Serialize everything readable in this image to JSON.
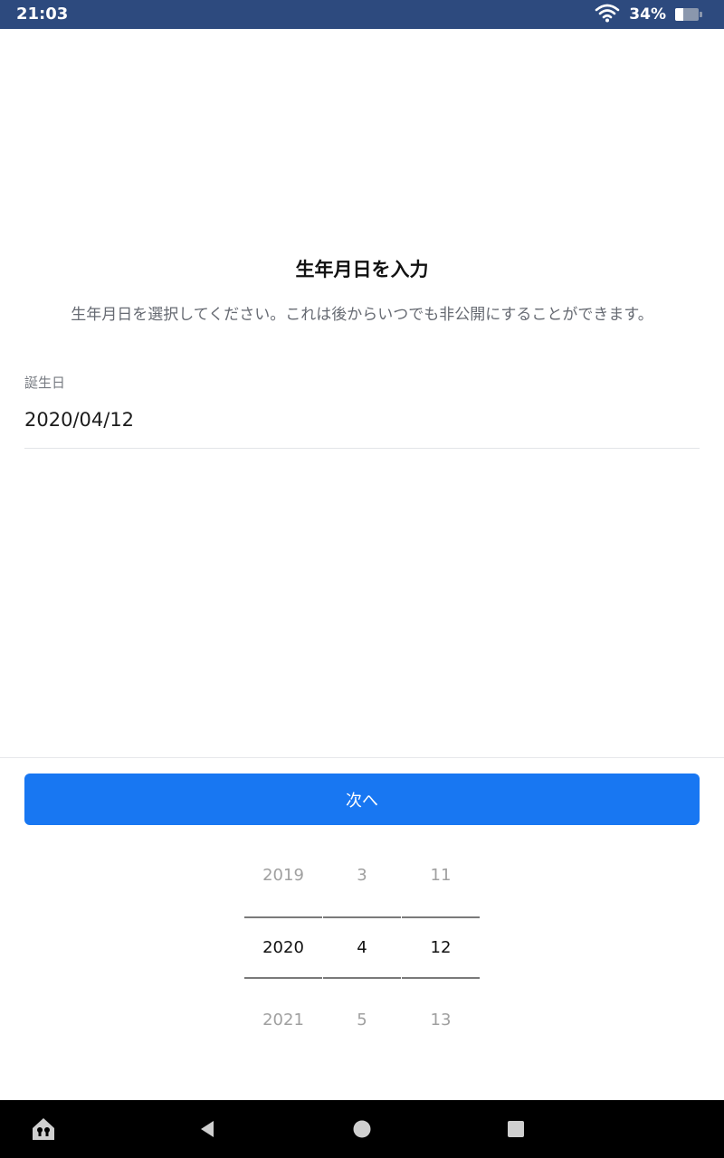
{
  "status_bar": {
    "time": "21:03",
    "battery_percent_label": "34%",
    "battery_level": 0.34,
    "icons": [
      "wifi-icon",
      "battery-icon"
    ]
  },
  "page": {
    "title": "生年月日を入力",
    "subtitle": "生年月日を選択してください。これは後からいつでも非公開にすることができます。"
  },
  "birthday_field": {
    "label": "誕生日",
    "value": "2020/04/12"
  },
  "next_button": {
    "label": "次へ",
    "color": "#1877f2"
  },
  "date_picker": {
    "year": {
      "prev": "2019",
      "current": "2020",
      "next": "2021"
    },
    "month": {
      "prev": "3",
      "current": "4",
      "next": "5"
    },
    "day": {
      "prev": "11",
      "current": "12",
      "next": "13"
    }
  },
  "nav_bar": {
    "icons": [
      "home-lock-icon",
      "back-icon",
      "home-icon",
      "recents-icon"
    ]
  },
  "colors": {
    "status_bar": "#2d4a7e",
    "accent": "#1877f2"
  }
}
